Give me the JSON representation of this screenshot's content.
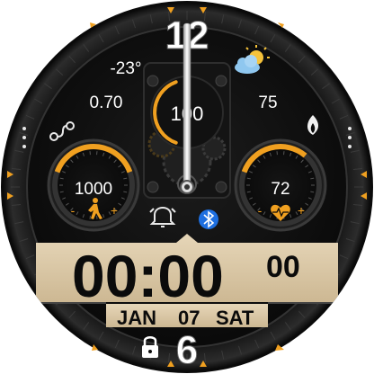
{
  "watch": {
    "accent_color": "#f0a020",
    "background_color": "#0a0a0a",
    "panel_color": "#d9c7a8",
    "markers": {
      "top": "12",
      "bottom": "6"
    },
    "temperature": "-23°",
    "weather_icon": "partly-cloudy-icon",
    "left_value": "0.70",
    "right_value": "75",
    "center_value": "100",
    "left_icon": "route-icon",
    "right_icon": "flame-icon",
    "steps": {
      "value": "1000",
      "minus": "-",
      "plus": "+",
      "icon": "walking-icon"
    },
    "heart": {
      "value": "72",
      "minus": "-",
      "plus": "+",
      "icon": "heart-icon"
    },
    "status_icons": [
      "alarm-icon",
      "bluetooth-icon"
    ],
    "time": {
      "hhmm": "00:00",
      "seconds": "00"
    },
    "date": {
      "month": "JAN",
      "day": "07",
      "weekday": "SAT"
    },
    "lock_icon": "lock-icon"
  }
}
